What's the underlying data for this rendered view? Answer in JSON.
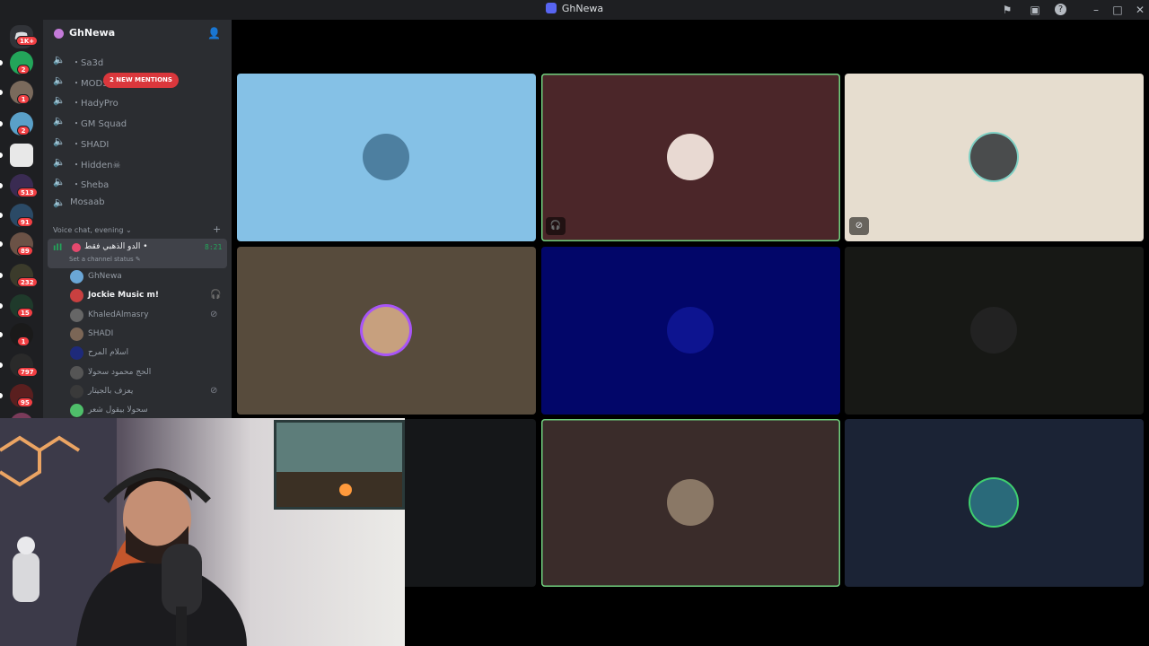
{
  "window": {
    "title": "GhNewa"
  },
  "colors": {
    "blurple": "#5865f2",
    "green": "#23a55a",
    "red": "#f23f43",
    "speaking_border": "#6fcf7d"
  },
  "rail": {
    "home_badge": "1K+",
    "servers": [
      {
        "name": "discord-server",
        "badge": "2",
        "color": "#23a55a"
      },
      {
        "name": "server-2",
        "badge": "1",
        "color": "#7a6a5c"
      },
      {
        "name": "server-3",
        "badge": "2",
        "color": "#5aa0c8"
      },
      {
        "name": "pubg-server",
        "badge": "",
        "color": "#e8e8e8"
      },
      {
        "name": "server-5",
        "badge": "513",
        "color": "#3a2b52"
      },
      {
        "name": "server-6",
        "badge": "91",
        "color": "#2b4a66"
      },
      {
        "name": "server-7",
        "badge": "89",
        "color": "#6b5246"
      },
      {
        "name": "server-8",
        "badge": "232",
        "color": "#3b3b2b"
      },
      {
        "name": "server-9",
        "badge": "15",
        "color": "#1f3a2b"
      },
      {
        "name": "sh-server",
        "badge": "1",
        "color": "#1a1a1a"
      },
      {
        "name": "server-11",
        "badge": "797",
        "color": "#2a2a2a"
      },
      {
        "name": "server-12",
        "badge": "95",
        "color": "#5a1f1f"
      },
      {
        "name": "server-13",
        "badge": "",
        "color": "#7a3b5a"
      }
    ]
  },
  "sidebar": {
    "server_name": "GhNewa",
    "mentions_pill": "2 NEW MENTIONS",
    "channels": [
      {
        "label": "・Sa3d"
      },
      {
        "label": "・MODS"
      },
      {
        "label": "・HadyPro"
      },
      {
        "label": "・GM Squad"
      },
      {
        "label": "・SHADI"
      },
      {
        "label": "・Hidden☠"
      },
      {
        "label": "・Sheba"
      },
      {
        "label": "Mosaab"
      }
    ],
    "category": "Voice chat, evening",
    "active_channel": {
      "name": "الدو الذهبي فقط •",
      "time": "8:21",
      "status": "Set a channel status"
    },
    "members": [
      {
        "name": "GhNewa",
        "bold": false,
        "icon": "",
        "color": "#6aa6d6"
      },
      {
        "name": "Jockie Music m!",
        "bold": true,
        "icon": "headphones-icon",
        "color": "#c94040"
      },
      {
        "name": "KhaledAlmasry",
        "bold": false,
        "icon": "mic-muted-icon",
        "color": "#666"
      },
      {
        "name": "SHADI",
        "bold": false,
        "icon": "",
        "color": "#7b6656"
      },
      {
        "name": "اسلام المرح",
        "bold": false,
        "icon": "",
        "color": "#1e2a7a"
      },
      {
        "name": "الحج محمود سحولا",
        "bold": false,
        "icon": "",
        "color": "#555"
      },
      {
        "name": "يعزف بالجيتار",
        "bold": false,
        "icon": "mic-muted-icon",
        "color": "#3a3a3a"
      },
      {
        "name": "سحولا بيقول شعر",
        "bold": false,
        "icon": "",
        "color": "#4fbf6a"
      }
    ]
  },
  "tiles": [
    {
      "name": "tile-1",
      "bg": "#85c1e6",
      "av": "#4d7fa0",
      "speaking": false,
      "corner": ""
    },
    {
      "name": "tile-2",
      "bg": "#4b2629",
      "av": "#e8d9d2",
      "speaking": true,
      "corner": "headphones-icon"
    },
    {
      "name": "tile-3",
      "bg": "#e6ddcf",
      "av": "#4a4c4d",
      "speaking": false,
      "corner": "mic-muted-icon"
    },
    {
      "name": "tile-4",
      "bg": "#574b3c",
      "av": "#c7a07e",
      "speaking": false,
      "corner": ""
    },
    {
      "name": "tile-5",
      "bg": "#020669",
      "av": "#0d1490",
      "speaking": false,
      "corner": ""
    },
    {
      "name": "tile-6",
      "bg": "#171815",
      "av": "#222",
      "speaking": false,
      "corner": ""
    },
    {
      "name": "tile-7",
      "bg": "#151719",
      "av": "",
      "speaking": false,
      "corner": ""
    },
    {
      "name": "tile-8",
      "bg": "#3a2c2a",
      "av": "#8a7866",
      "speaking": true,
      "corner": ""
    },
    {
      "name": "tile-9",
      "bg": "#1b2335",
      "av": "#2a6a7a",
      "speaking": false,
      "corner": ""
    }
  ]
}
